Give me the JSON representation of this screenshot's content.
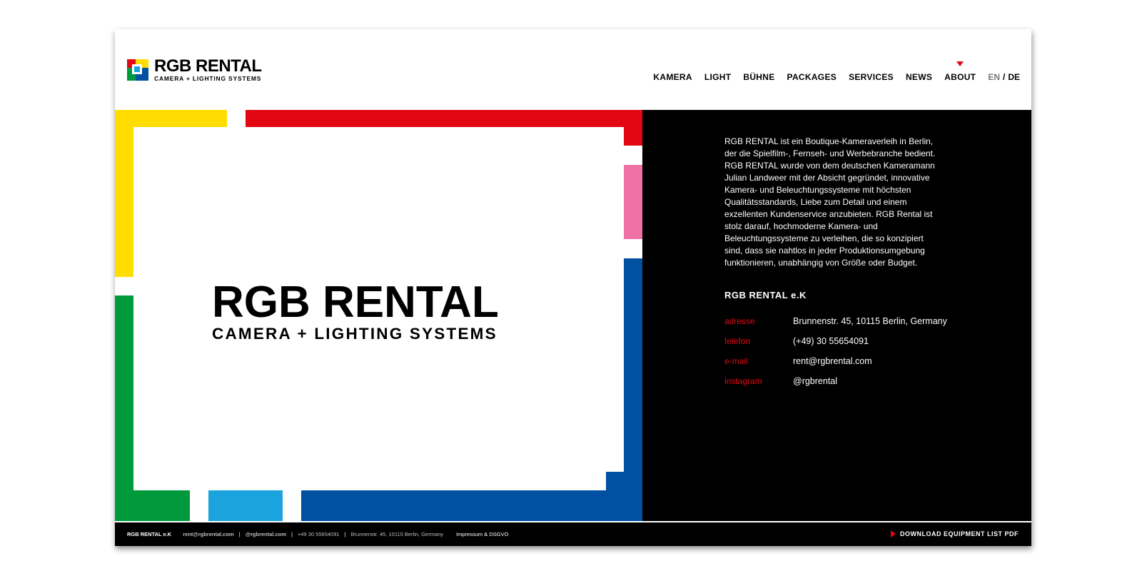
{
  "brand": {
    "name": "RGB RENTAL",
    "tagline": "CAMERA + LIGHTING SYSTEMS"
  },
  "nav": {
    "items": [
      {
        "label": "KAMERA"
      },
      {
        "label": "LIGHT"
      },
      {
        "label": "BÜHNE"
      },
      {
        "label": "PACKAGES"
      },
      {
        "label": "SERVICES"
      },
      {
        "label": "NEWS"
      },
      {
        "label": "ABOUT",
        "active": true
      }
    ],
    "lang_en": "EN",
    "lang_sep": "/",
    "lang_de": "DE"
  },
  "colors": {
    "red": "#e30613",
    "yellow": "#ffdd00",
    "green": "#009a3d",
    "blue": "#0051a2",
    "light_blue": "#1ba3dd",
    "pink": "#ee72a6"
  },
  "about": {
    "text": "RGB RENTAL ist ein Boutique-Kameraverleih in Berlin, der die Spielfilm-, Fernseh- und Werbebranche bedient. RGB RENTAL wurde von dem deutschen Kameramann Julian Landweer mit der Absicht gegründet, innovative Kamera- und Beleuchtungssysteme mit höchsten Qualitätsstandards, Liebe zum Detail und einem exzellenten Kundenservice anzubieten. RGB Rental ist stolz darauf, hochmoderne Kamera- und Beleuchtungssysteme zu verleihen, die so konzipiert sind, dass sie nahtlos in jeder Produktionsumgebung funktionieren, unabhängig von Größe oder Budget.",
    "company": "RGB RENTAL e.K",
    "contacts": [
      {
        "label": "adresse",
        "value": "Brunnenstr. 45, 10115 Berlin, Germany"
      },
      {
        "label": "telefon",
        "value": "(+49) 30 55654091"
      },
      {
        "label": "e-mail",
        "value": "rent@rgbrental.com"
      },
      {
        "label": "instagram",
        "value": "@rgbrental"
      }
    ]
  },
  "footer": {
    "brand": "RGB RENTAL e.K",
    "email": "rent@rgbrental.com",
    "instagram": "@rgbrental.com",
    "phone": "+49 30 55654091",
    "address": "Brunnenstr. 45, 10115 Berlin, Germany",
    "sep": "|",
    "legal": "Impressum & DSGVO",
    "download": "DOWNLOAD EQUIPMENT LIST PDF"
  }
}
